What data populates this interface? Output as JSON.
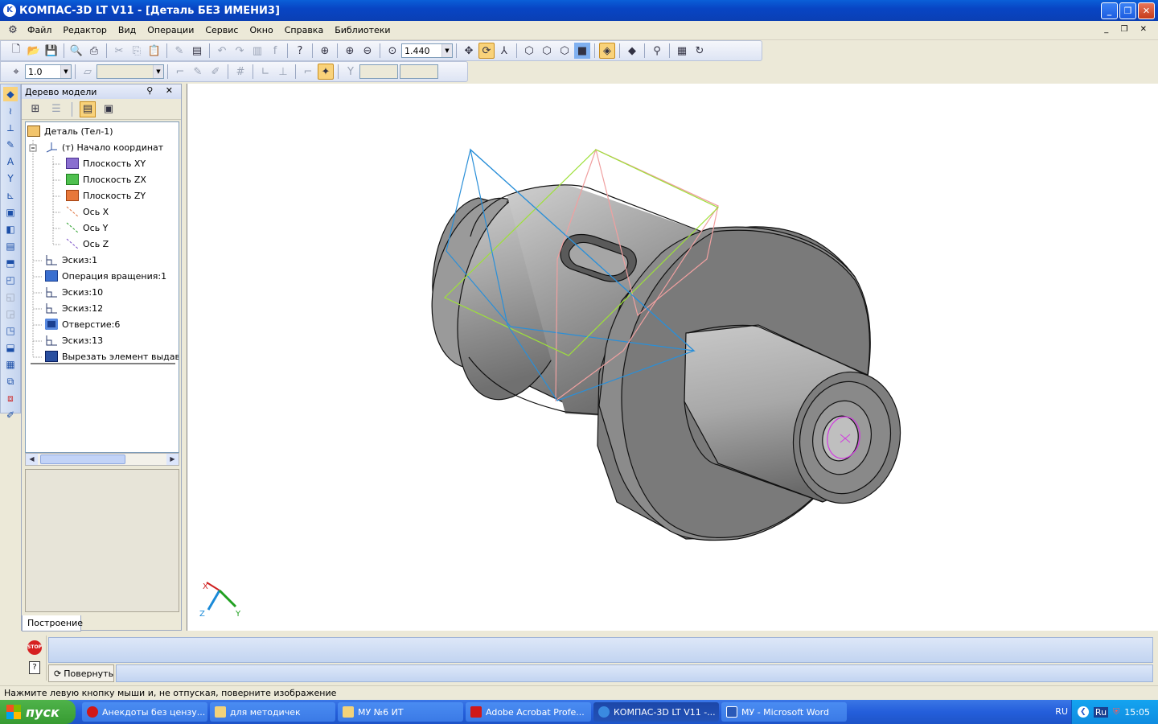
{
  "window": {
    "title": "КОМПАС-3D LT V11 - [Деталь БЕЗ ИМЕНИ3]",
    "app_icon": "kompas-logo-icon"
  },
  "menu": [
    "Файл",
    "Редактор",
    "Вид",
    "Операции",
    "Сервис",
    "Окно",
    "Справка",
    "Библиотеки"
  ],
  "toolbar": {
    "zoom_value": "1.440",
    "step_value": "1.0"
  },
  "model_tree": {
    "title": "Дерево модели",
    "items": [
      {
        "label": "Деталь (Тел-1)",
        "icon": "part-icon"
      },
      {
        "label": "(т) Начало координат",
        "icon": "origin-icon"
      },
      {
        "label": "Плоскость XY",
        "icon": "plane-xy-icon"
      },
      {
        "label": "Плоскость ZX",
        "icon": "plane-zx-icon"
      },
      {
        "label": "Плоскость ZY",
        "icon": "plane-zy-icon"
      },
      {
        "label": "Ось X",
        "icon": "axis-x-icon"
      },
      {
        "label": "Ось Y",
        "icon": "axis-y-icon"
      },
      {
        "label": "Ось Z",
        "icon": "axis-z-icon"
      },
      {
        "label": "Эскиз:1",
        "icon": "sketch-icon"
      },
      {
        "label": "Операция вращения:1",
        "icon": "revolve-icon"
      },
      {
        "label": "Эскиз:10",
        "icon": "sketch-icon"
      },
      {
        "label": "Эскиз:12",
        "icon": "sketch-icon"
      },
      {
        "label": "Отверстие:6",
        "icon": "hole-icon"
      },
      {
        "label": "Эскиз:13",
        "icon": "sketch-icon"
      },
      {
        "label": "Вырезать элемент выдавли",
        "icon": "extrude-cut-icon"
      }
    ],
    "tab": "Построение"
  },
  "triad": {
    "x": "X",
    "y": "Y",
    "z": "Z"
  },
  "bottom": {
    "rotate_label": "Повернуть"
  },
  "status_text": "Нажмите левую кнопку мыши и, не отпуская, поверните изображение",
  "taskbar": {
    "start": "пуск",
    "tasks": [
      {
        "label": "Анекдоты без цензу...",
        "icon": "opera-icon"
      },
      {
        "label": "для методичек",
        "icon": "folder-icon"
      },
      {
        "label": "МУ №6 ИТ",
        "icon": "folder-icon"
      },
      {
        "label": "Adobe Acrobat Profe...",
        "icon": "acrobat-icon"
      },
      {
        "label": "КОМПАС-3D LT V11 -...",
        "icon": "kompas-icon"
      },
      {
        "label": "МУ - Microsoft Word",
        "icon": "word-icon"
      }
    ],
    "lang": "RU",
    "lang2": "Ru",
    "clock": "15:05"
  }
}
